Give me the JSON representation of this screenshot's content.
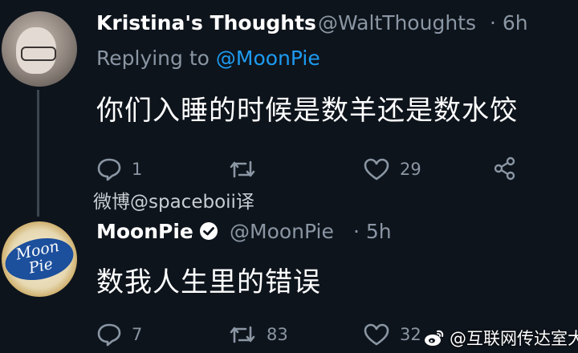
{
  "tweet1": {
    "author_name": "Kristina's Thoughts",
    "author_handle": "@WaltThoughts",
    "time": "· 6h",
    "replying_prefix": "Replying to ",
    "replying_to": "@MoonPie",
    "text": "你们入睡的时候是数羊还是数水饺",
    "reply_count": "1",
    "retweet_count": "",
    "like_count": "29"
  },
  "translation_credit": "微博@spaceboii译",
  "tweet2": {
    "author_name": "MoonPie",
    "author_handle": "@MoonPie",
    "time": "· 5h",
    "text": "数我人生里的错误",
    "reply_count": "7",
    "retweet_count": "83",
    "like_count": "32"
  },
  "avatar_logo": {
    "line1": "Moon",
    "line2": "Pie"
  },
  "watermark": {
    "text": "@互联网传达室大爷",
    "icon": "weibo-icon"
  },
  "colors": {
    "background": "#0e141c",
    "muted": "#8a96a3",
    "link": "#1d9bf0"
  }
}
